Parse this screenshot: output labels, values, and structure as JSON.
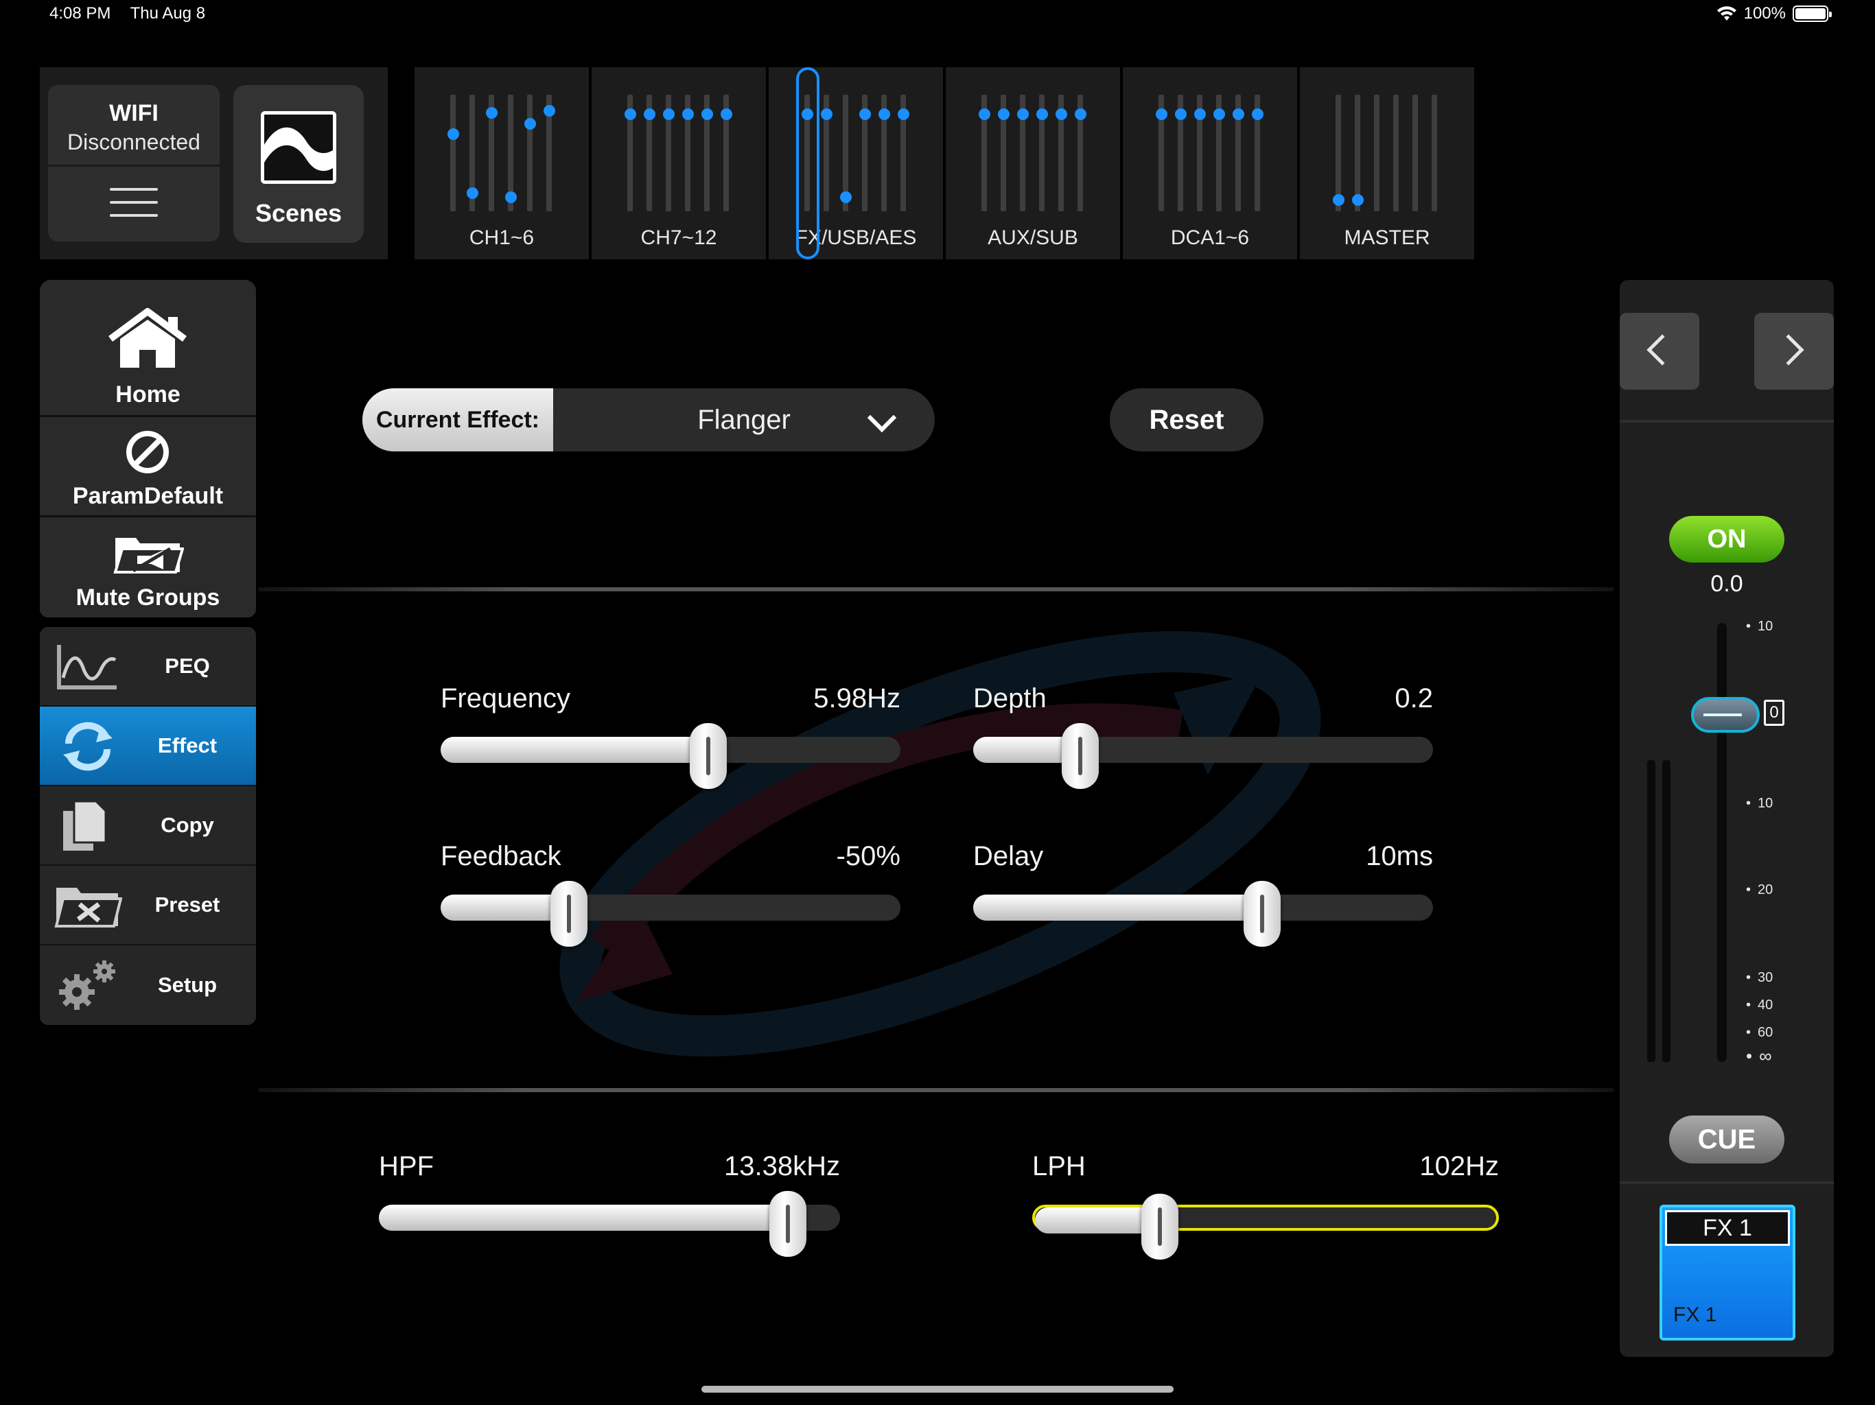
{
  "status_bar": {
    "time": "4:08 PM",
    "date": "Thu Aug 8",
    "battery": "100%"
  },
  "top_left": {
    "wifi_title": "WIFI",
    "wifi_status": "Disconnected",
    "scenes_label": "Scenes"
  },
  "tabs": [
    {
      "label": "CH1~6",
      "dots": [
        0.32,
        0.88,
        0.12,
        0.92,
        0.22,
        0.1
      ]
    },
    {
      "label": "CH7~12",
      "dots": [
        0.13,
        0.13,
        0.13,
        0.13,
        0.13,
        0.13
      ]
    },
    {
      "label": "FX/USB/AES",
      "dots": [
        0.13,
        0.13,
        0.92,
        0.13,
        0.13,
        0.13
      ]
    },
    {
      "label": "AUX/SUB",
      "dots": [
        0.13,
        0.13,
        0.13,
        0.13,
        0.13,
        0.13
      ]
    },
    {
      "label": "DCA1~6",
      "dots": [
        0.13,
        0.13,
        0.13,
        0.13,
        0.13,
        0.13
      ]
    },
    {
      "label": "MASTER",
      "dots": [
        0.95,
        0.95,
        null,
        null,
        null,
        null
      ]
    }
  ],
  "selected_tab": "FX/USB/AES",
  "left_menu": {
    "home": "Home",
    "param_default": "ParamDefault",
    "mute_groups": "Mute Groups",
    "peq": "PEQ",
    "effect": "Effect",
    "copy": "Copy",
    "preset": "Preset",
    "setup": "Setup"
  },
  "effect": {
    "label": "Current Effect:",
    "value": "Flanger",
    "reset_label": "Reset"
  },
  "params": {
    "frequency": {
      "name": "Frequency",
      "value": "5.98Hz",
      "level": 0.59
    },
    "depth": {
      "name": "Depth",
      "value": "0.2",
      "level": 0.21
    },
    "feedback": {
      "name": "Feedback",
      "value": "-50%",
      "level": 0.26
    },
    "delay": {
      "name": "Delay",
      "value": "10ms",
      "level": 0.64
    },
    "hpf": {
      "name": "HPF",
      "value": "13.38kHz",
      "level": 0.92
    },
    "lph": {
      "name": "LPH",
      "value": "102Hz",
      "level": 0.25
    }
  },
  "right_panel": {
    "on_label": "ON",
    "level_value": "0.0",
    "scale": [
      "10",
      "10",
      "20",
      "30",
      "40",
      "60",
      "∞"
    ],
    "zero_label": "0",
    "cue_label": "CUE",
    "fx_top": "FX 1",
    "fx_bottom": "FX 1"
  },
  "colors": {
    "accent_blue": "#1a8fff",
    "on_green": "#5cc414",
    "highlight_yellow": "#e8e600"
  }
}
